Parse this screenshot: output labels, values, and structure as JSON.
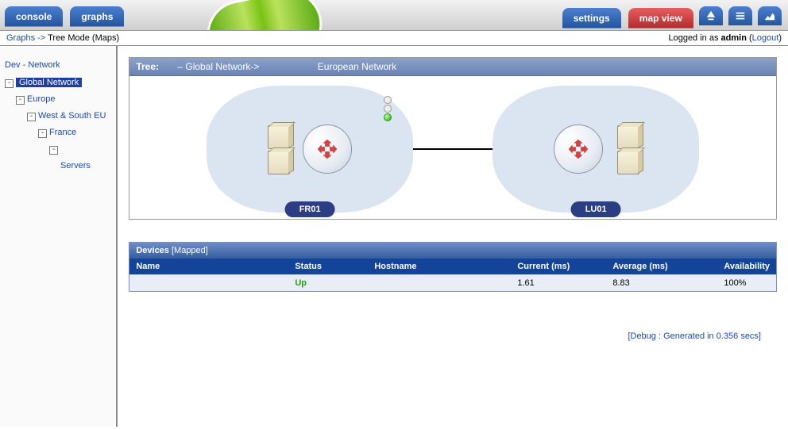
{
  "header": {
    "tabs_left": [
      "console",
      "graphs"
    ],
    "tabs_right": [
      {
        "label": "settings",
        "style": "blue"
      },
      {
        "label": "map view",
        "style": "red"
      }
    ]
  },
  "breadcrumb": {
    "root": "Graphs",
    "sep": " -> ",
    "current": "Tree Mode (Maps)",
    "logged_in_prefix": "Logged in as ",
    "user": "admin",
    "logout": "Logout"
  },
  "sidebar": {
    "items": [
      {
        "indent": 0,
        "toggle": "",
        "label": "Dev - Network"
      },
      {
        "indent": 0,
        "toggle": "-",
        "label": "Global Network",
        "selected": true
      },
      {
        "indent": 1,
        "toggle": "-",
        "label": "Europe"
      },
      {
        "indent": 2,
        "toggle": "-",
        "label": "West & South EU"
      },
      {
        "indent": 3,
        "toggle": "-",
        "label": "France"
      },
      {
        "indent": 4,
        "toggle": "-",
        "label": ""
      },
      {
        "indent": 5,
        "toggle": "",
        "label": "Servers"
      }
    ]
  },
  "mappanel": {
    "title_prefix": "Tree:",
    "title_sep": " – ",
    "title_parent": "Global Network->",
    "title_current": "European Network",
    "nodes": [
      {
        "label": "FR01",
        "has_led": true,
        "led_green": true
      },
      {
        "label": "LU01",
        "has_led": false
      }
    ]
  },
  "devices_table": {
    "title": "Devices",
    "title_suffix": " [Mapped]",
    "columns": [
      "Name",
      "Status",
      "Hostname",
      "Current (ms)",
      "Average (ms)",
      "Availability"
    ],
    "rows": [
      {
        "name": "",
        "status": "Up",
        "hostname": "",
        "current": "1.61",
        "average": "8.83",
        "availability": "100%"
      }
    ]
  },
  "debug": {
    "text": "[Debug : Generated in 0.356 secs]"
  }
}
